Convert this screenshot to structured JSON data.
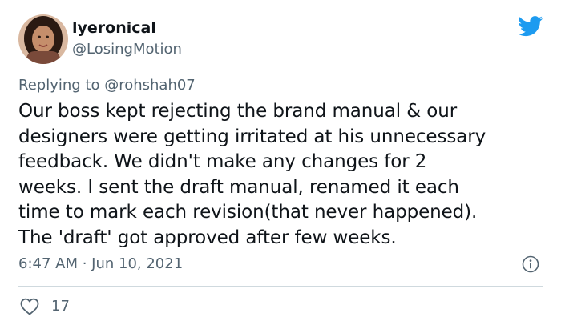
{
  "author": {
    "display_name": "lyeronical",
    "handle": "@LosingMotion"
  },
  "reply": {
    "prefix": "Replying to ",
    "mention": "@rohshah07"
  },
  "tweet": {
    "text": "Our boss kept rejecting the brand manual & our\ndesigners were getting irritated at his unnecessary\nfeedback. We didn't make any changes for 2\nweeks. I sent the draft manual, renamed it each\ntime to mark each revision(that never happened).\nThe 'draft' got approved after few weeks."
  },
  "meta": {
    "timestamp": "6:47 AM · Jun 10, 2021"
  },
  "actions": {
    "like_count": "17"
  },
  "icons": {
    "brand": "twitter-bird-icon",
    "info": "info-icon",
    "like": "heart-icon"
  },
  "colors": {
    "brand": "#1d9bf0",
    "text_primary": "#0f1419",
    "text_secondary": "#536471",
    "divider": "#cfd9de"
  }
}
